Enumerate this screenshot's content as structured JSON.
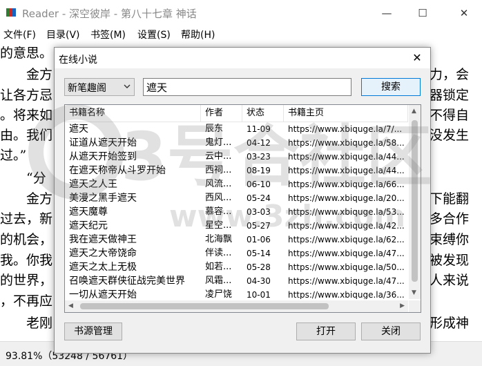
{
  "window": {
    "title": "Reader - 深空彼岸 - 第八十七章 神话",
    "minimize": "—",
    "maximize": "☐",
    "close": "✕"
  },
  "menubar": {
    "items": [
      "文件(F)",
      "目录(V)",
      "书签(M)",
      "设置(S)",
      "帮助(H)"
    ]
  },
  "reader": {
    "lines": [
      "的意思。",
      "　　金方",
      "让各方忌",
      "。将来如",
      "由。我们",
      "过。”",
      "　　“分",
      "　　金方",
      "过去，新",
      "的机会，",
      "我。你我",
      "的世界，",
      "，不再应",
      "　　老刚"
    ],
    "right_lines": [
      "力，会",
      "器锁定",
      "不得自",
      "没发生",
      "下能翻",
      "多合作",
      "束缚你",
      "被发现",
      "人来说",
      "形成神"
    ]
  },
  "watermark": {
    "text": "3号合社区",
    "url": "www.3zh.com"
  },
  "status": {
    "text": "93.81%（53248 / 56761）"
  },
  "dialog": {
    "title": "在线小说",
    "close": "✕",
    "source_select": "新笔趣阁",
    "search_value": "遮天",
    "search_button": "搜索",
    "columns": [
      "书籍名称",
      "作者",
      "状态",
      "书籍主页"
    ],
    "rows": [
      {
        "name": "遮天",
        "author": "辰东",
        "status": "11-09",
        "url": "https://www.xbiquge.la/7/..."
      },
      {
        "name": "证道从遮天开始",
        "author": "鬼灯...",
        "status": "04-12",
        "url": "https://www.xbiquge.la/58..."
      },
      {
        "name": "从遮天开始签到",
        "author": "云中...",
        "status": "03-23",
        "url": "https://www.xbiquge.la/44..."
      },
      {
        "name": "在遮天称帝从斗罗开始",
        "author": "西祠...",
        "status": "08-19",
        "url": "https://www.xbiquge.la/44..."
      },
      {
        "name": "遮天之人王",
        "author": "风流...",
        "status": "06-10",
        "url": "https://www.xbiquge.la/66..."
      },
      {
        "name": "美漫之黑手遮天",
        "author": "西风...",
        "status": "05-24",
        "url": "https://www.xbiquge.la/20..."
      },
      {
        "name": "遮天魔尊",
        "author": "慕容...",
        "status": "03-03",
        "url": "https://www.xbiquge.la/53..."
      },
      {
        "name": "遮天纪元",
        "author": "星空...",
        "status": "05-27",
        "url": "https://www.xbiquge.la/42..."
      },
      {
        "name": "我在遮天做神王",
        "author": "北海飘",
        "status": "01-06",
        "url": "https://www.xbiquge.la/62..."
      },
      {
        "name": "遮天之大帝饶命",
        "author": "伴读...",
        "status": "05-14",
        "url": "https://www.xbiquge.la/47..."
      },
      {
        "name": "遮天之太上无极",
        "author": "如若...",
        "status": "05-28",
        "url": "https://www.xbiquge.la/50..."
      },
      {
        "name": "召唤遮天群侠征战完美世界",
        "author": "风霜...",
        "status": "04-30",
        "url": "https://www.xbiquge.la/47..."
      },
      {
        "name": "一切从遮天开始",
        "author": "凌尸饶",
        "status": "10-01",
        "url": "https://www.xbiquge.la/36..."
      }
    ],
    "source_manage_button": "书源管理",
    "open_button": "打开",
    "close_button": "关闭"
  }
}
